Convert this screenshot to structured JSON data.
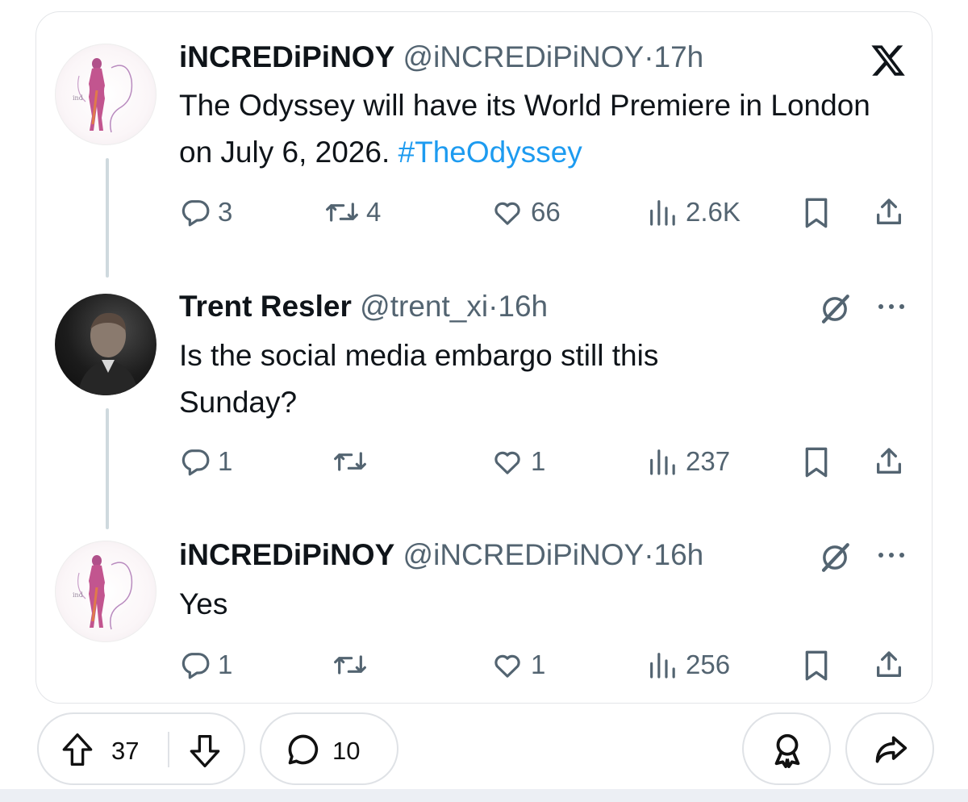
{
  "tweets": [
    {
      "name": "iNCREDiPiNOY",
      "handle": "@iNCREDiPiNOY",
      "separator": "·",
      "time": "17h",
      "text": "The Odyssey will have its World Premiere in London on July 6, 2026.",
      "hashtag": "#TheOdyssey",
      "replies": "3",
      "reposts": "4",
      "likes": "66",
      "views": "2.6K"
    },
    {
      "name": "Trent Resler",
      "handle": "@trent_xi",
      "separator": "·",
      "time": "16h",
      "text": "Is the social media embargo still this Sunday?",
      "replies": "1",
      "reposts": "",
      "likes": "1",
      "views": "237"
    },
    {
      "name": "iNCREDiPiNOY",
      "handle": "@iNCREDiPiNOY",
      "separator": "·",
      "time": "16h",
      "text": "Yes",
      "replies": "1",
      "reposts": "",
      "likes": "1",
      "views": "256"
    }
  ],
  "footer": {
    "upvotes": "37",
    "comments": "10"
  },
  "icons": {
    "platform": "x-logo-icon",
    "reply": "reply-icon",
    "repost": "repost-icon",
    "like": "heart-icon",
    "views": "views-icon",
    "bookmark": "bookmark-icon",
    "share": "share-icon",
    "more": "more-icon",
    "grok": "grok-icon",
    "upvote": "upvote-icon",
    "downvote": "downvote-icon",
    "comment": "comment-icon",
    "award": "award-icon",
    "forward": "forward-icon"
  },
  "colors": {
    "text": "#0f1419",
    "muted": "#536471",
    "hashtag": "#1d9bf0",
    "thread_line": "#cfd9de",
    "card_border": "#e3e5e8"
  }
}
